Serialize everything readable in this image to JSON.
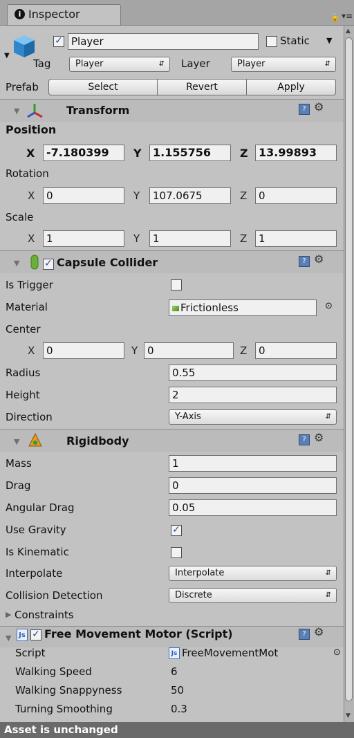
{
  "tab": {
    "label": "Inspector"
  },
  "object": {
    "name": "Player",
    "static_label": "Static",
    "tag_label": "Tag",
    "tag_value": "Player",
    "layer_label": "Layer",
    "layer_value": "Player",
    "prefab_label": "Prefab",
    "select_label": "Select",
    "revert_label": "Revert",
    "apply_label": "Apply"
  },
  "transform": {
    "title": "Transform",
    "position_label": "Position",
    "position": {
      "x": "-7.180399",
      "y": "1.155756",
      "z": "13.99893"
    },
    "rotation_label": "Rotation",
    "rotation": {
      "x": "0",
      "y": "107.0675",
      "z": "0"
    },
    "scale_label": "Scale",
    "scale": {
      "x": "1",
      "y": "1",
      "z": "1"
    }
  },
  "axes": {
    "x": "X",
    "y": "Y",
    "z": "Z"
  },
  "capsule": {
    "title": "Capsule Collider",
    "is_trigger_label": "Is Trigger",
    "material_label": "Material",
    "material_value": "Frictionless",
    "center_label": "Center",
    "center": {
      "x": "0",
      "y": "0",
      "z": "0"
    },
    "radius_label": "Radius",
    "radius_value": "0.55",
    "height_label": "Height",
    "height_value": "2",
    "direction_label": "Direction",
    "direction_value": "Y-Axis"
  },
  "rigidbody": {
    "title": "Rigidbody",
    "mass_label": "Mass",
    "mass_value": "1",
    "drag_label": "Drag",
    "drag_value": "0",
    "angular_drag_label": "Angular Drag",
    "angular_drag_value": "0.05",
    "use_gravity_label": "Use Gravity",
    "is_kinematic_label": "Is Kinematic",
    "interpolate_label": "Interpolate",
    "interpolate_value": "Interpolate",
    "collision_label": "Collision Detection",
    "collision_value": "Discrete",
    "constraints_label": "Constraints"
  },
  "script_comp": {
    "title": "Free Movement Motor (Script)",
    "script_label": "Script",
    "script_value": "FreeMovementMot",
    "walking_speed_label": "Walking Speed",
    "walking_speed_value": "6",
    "walking_snappyness_label": "Walking Snappyness",
    "walking_snappyness_value": "50",
    "turning_smoothing_label": "Turning Smoothing",
    "turning_smoothing_value": "0.3"
  },
  "status": "Asset is unchanged",
  "colors": {
    "transform_axis_x": "#cc2b2b",
    "transform_axis_y": "#2f9d2f",
    "transform_axis_z": "#2c55c9",
    "capsule_green": "#6ab13a",
    "rigidbody_orange": "#e09a25",
    "cube_blue": "#3a9be0"
  },
  "icons": [
    "info-icon",
    "lock-icon",
    "tab-menu-icon",
    "cube-icon",
    "transform-icon",
    "capsule-icon",
    "rigidbody-icon",
    "js-script-icon",
    "help-icon",
    "gear-icon",
    "material-icon",
    "object-picker-icon"
  ]
}
